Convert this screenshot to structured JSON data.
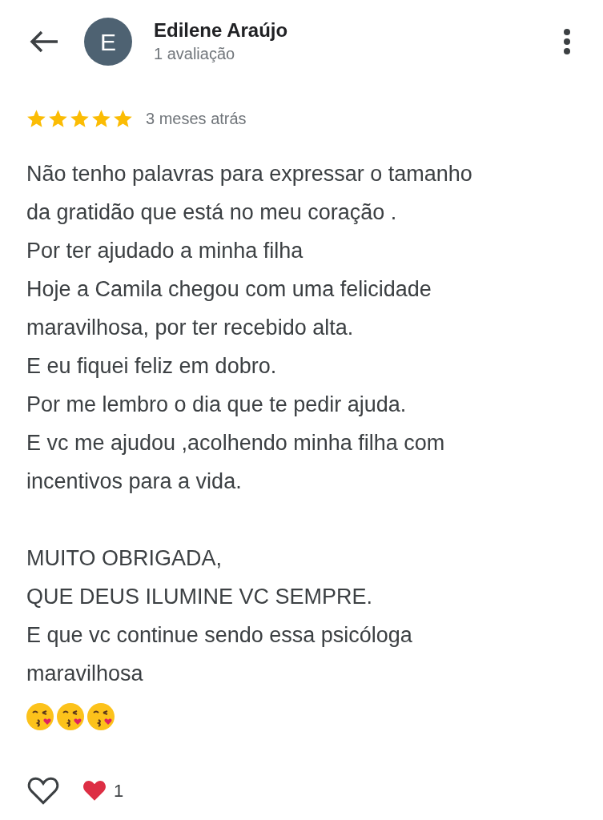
{
  "header": {
    "avatar_letter": "E",
    "name": "Edilene Araújo",
    "subtitle": "1 avaliação"
  },
  "review": {
    "stars": 5,
    "time": "3 meses atrás",
    "paragraphs": [
      [
        "Não tenho palavras para expressar o tamanho",
        "da gratidão que está no meu coração .",
        "Por ter ajudado a minha filha",
        "Hoje a Camila chegou com uma felicidade",
        "maravilhosa, por ter recebido alta.",
        "E eu fiquei feliz em dobro.",
        "Por me lembro o dia que te pedir ajuda.",
        "E vc me ajudou ,acolhendo minha filha com",
        "incentivos para a vida."
      ],
      [
        "MUITO OBRIGADA,",
        "QUE DEUS ILUMINE VC SEMPRE.",
        "E que vc continue sendo essa psicóloga",
        "maravilhosa"
      ]
    ],
    "emojis": [
      {
        "kind": "kiss"
      },
      {
        "kind": "kiss"
      },
      {
        "kind": "kiss"
      }
    ]
  },
  "reactions": {
    "liked": false,
    "heart_count": "1"
  }
}
